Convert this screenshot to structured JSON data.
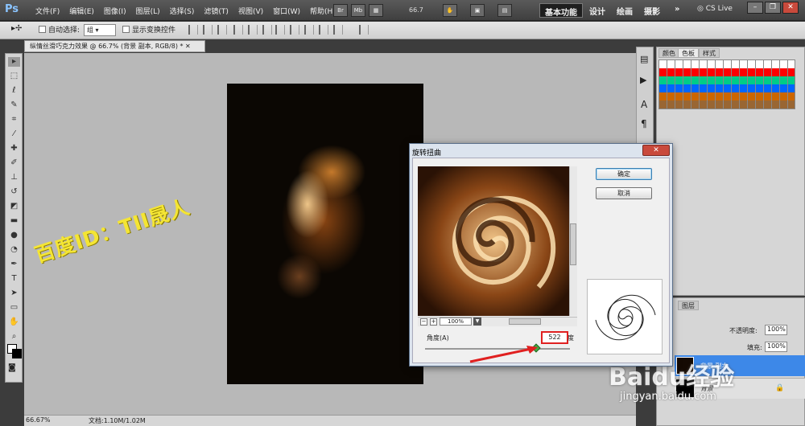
{
  "app": {
    "logo": "Ps",
    "zoom": "66.7",
    "workspace_active": "基本功能",
    "workspaces": [
      "设计",
      "绘画",
      "摄影"
    ],
    "cs_live": "CS Live"
  },
  "menu": [
    "文件(F)",
    "编辑(E)",
    "图像(I)",
    "图层(L)",
    "选择(S)",
    "滤镜(T)",
    "视图(V)",
    "窗口(W)",
    "帮助(H)"
  ],
  "toolbar_mini": [
    "Br",
    "Mb"
  ],
  "options": {
    "auto_select_label": "自动选择:",
    "group_value": "组",
    "show_transform_label": "显示变换控件"
  },
  "document": {
    "tab_title": "纵情丝滑巧克力效果 @ 66.7% (背景 副本, RGB/8) *"
  },
  "watermark": "百度ID：TII晟人",
  "status": {
    "zoom": "66.67%",
    "doc_size": "文档:1.10M/1.02M"
  },
  "panels": {
    "tabs": [
      "颜色",
      "色板",
      "样式"
    ],
    "layers_tab": "图层",
    "opacity_label": "不透明度:",
    "opacity_value": "100%",
    "fill_label": "填充:",
    "fill_value": "100%",
    "layer_copy_name": "背景 副本",
    "layer_bg_name": "背景"
  },
  "dialog": {
    "title": "旋转扭曲",
    "ok": "确定",
    "cancel": "取消",
    "zoom_value": "100%",
    "angle_label": "角度(A)",
    "angle_value": "522",
    "degree_unit": "度"
  },
  "baidu": {
    "logo": "Baidu经验",
    "url": "jingyan.baidu.com"
  }
}
